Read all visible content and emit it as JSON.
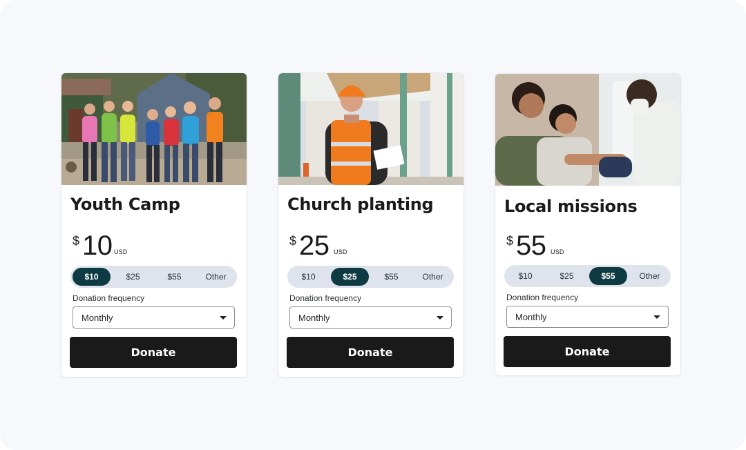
{
  "colors": {
    "background": "#f6f8fc",
    "card": "#ffffff",
    "selected_chip": "#0e3b43",
    "chip_track": "#dee3ec",
    "button": "#1a1a1a"
  },
  "cards": [
    {
      "title": "Youth Camp",
      "photo_icon": "youth-camp-photo",
      "currency_symbol": "$",
      "amount": "10",
      "currency": "USD",
      "amount_options": [
        "$10",
        "$25",
        "$55",
        "Other"
      ],
      "selected_option": "$10",
      "frequency_label": "Donation frequency",
      "frequency_value": "Monthly",
      "button_label": "Donate"
    },
    {
      "title": "Church planting",
      "photo_icon": "construction-worker-photo",
      "currency_symbol": "$",
      "amount": "25",
      "currency": "USD",
      "amount_options": [
        "$10",
        "$25",
        "$55",
        "Other"
      ],
      "selected_option": "$25",
      "frequency_label": "Donation frequency",
      "frequency_value": "Monthly",
      "button_label": "Donate"
    },
    {
      "title": "Local missions",
      "photo_icon": "medical-care-photo",
      "currency_symbol": "$",
      "amount": "55",
      "currency": "USD",
      "amount_options": [
        "$10",
        "$25",
        "$55",
        "Other"
      ],
      "selected_option": "$55",
      "frequency_label": "Donation frequency",
      "frequency_value": "Monthly",
      "button_label": "Donate"
    }
  ]
}
